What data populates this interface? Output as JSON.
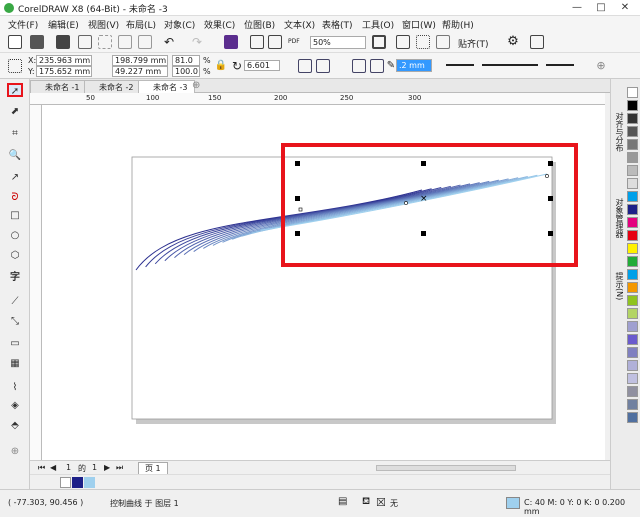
{
  "window": {
    "title": "CorelDRAW X8 (64-Bit) - 未命名 -3",
    "minimize": "—",
    "maximize": "□",
    "close": "✕"
  },
  "menu": [
    "文件(F)",
    "编辑(E)",
    "视图(V)",
    "布局(L)",
    "对象(C)",
    "效果(C)",
    "位图(B)",
    "文本(X)",
    "表格(T)",
    "工具(O)",
    "窗口(W)",
    "帮助(H)"
  ],
  "toolbar": {
    "zoom_value": "50%",
    "snap_label": "贴齐(T)"
  },
  "properties": {
    "x_label": "X:",
    "x_value": "235.963 mm",
    "y_label": "Y:",
    "y_value": "175.652 mm",
    "w_value": "198.799 mm",
    "h_value": "49.227 mm",
    "scale_w": "81.0",
    "scale_h": "100.0",
    "percent": "%",
    "rotation": "6.601",
    "outline_width": ".2 mm"
  },
  "doc_tabs": [
    "未命名 -1",
    "未命名 -2",
    "未命名 -3"
  ],
  "ruler_marks": [
    "50",
    "100",
    "150",
    "200",
    "250",
    "300"
  ],
  "docker_tabs": [
    "对齐与分布",
    "对象管理器",
    "提示(N)"
  ],
  "page_nav": {
    "current": "1",
    "of": "的",
    "total": "1",
    "page_tab": "页 1"
  },
  "status": {
    "coords": "( -77.303, 90.456 )",
    "description": "控制曲线 于 图层 1",
    "fill_label": "无",
    "outline_info": "C: 40 M: 0 Y: 0 K: 0  0.200 mm"
  },
  "colors": {
    "highlight": "#e8141b",
    "curve_dark": "#2b2f8f",
    "curve_light": "#9fd0ee"
  },
  "palette": [
    "#ffffff",
    "#000000",
    "#333333",
    "#555555",
    "#777777",
    "#999999",
    "#bbbbbb",
    "#dddddd",
    "#00a0e9",
    "#1d2088",
    "#e4007f",
    "#e60012",
    "#fff100",
    "#22ac38",
    "#00a0e9",
    "#f39800",
    "#8fc31f",
    "#b3d465",
    "#a0a0d0",
    "#6a5acd",
    "#8080c0",
    "#b0b0d8",
    "#c0c0e0",
    "#9090a0",
    "#7080a0",
    "#5070a0"
  ],
  "icons": [
    "pick-tool-icon",
    "shape-tool-icon",
    "crop-icon",
    "zoom-icon",
    "freehand-icon",
    "artistic-media-icon",
    "rectangle-icon",
    "ellipse-icon",
    "polygon-icon",
    "text-icon",
    "parallel-dimension-icon",
    "connector-icon",
    "drop-shadow-icon",
    "transparency-icon",
    "eyedropper-icon",
    "interactive-fill-icon",
    "smart-fill-icon",
    "add-icon"
  ]
}
